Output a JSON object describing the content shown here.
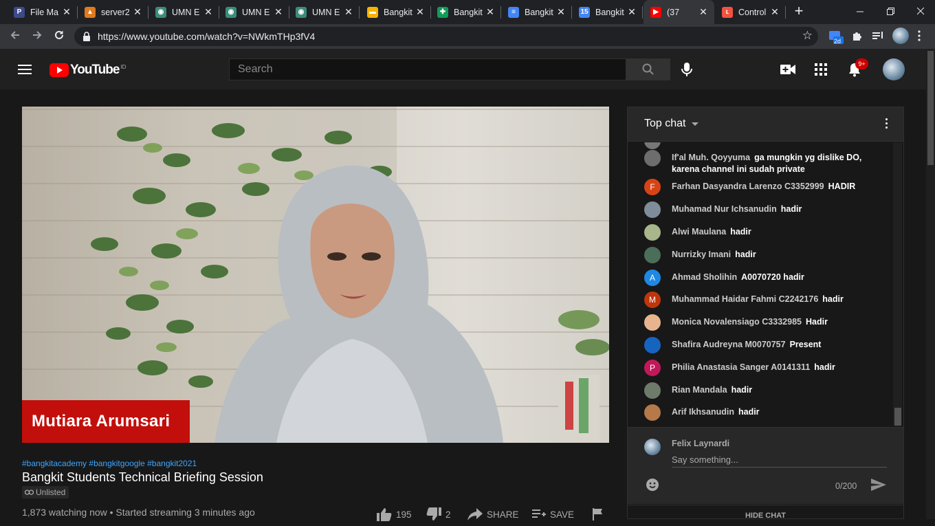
{
  "browser": {
    "tabs": [
      {
        "title": "File Ma",
        "icon": "p-icon",
        "color": "#3c4a8a",
        "glyph": "P"
      },
      {
        "title": "server2",
        "icon": "server-icon",
        "color": "#e07a1f",
        "glyph": "▲"
      },
      {
        "title": "UMN E",
        "icon": "umn-icon",
        "color": "#3a8c7a",
        "glyph": "◉"
      },
      {
        "title": "UMN E",
        "icon": "umn-icon",
        "color": "#3a8c7a",
        "glyph": "◉"
      },
      {
        "title": "UMN E",
        "icon": "umn-icon",
        "color": "#3a8c7a",
        "glyph": "◉"
      },
      {
        "title": "Bangkit",
        "icon": "slides-icon",
        "color": "#f4b400",
        "glyph": "▬"
      },
      {
        "title": "Bangkit",
        "icon": "sheets-icon",
        "color": "#0f9d58",
        "glyph": "✚"
      },
      {
        "title": "Bangkit",
        "icon": "docs-icon",
        "color": "#4285f4",
        "glyph": "≡"
      },
      {
        "title": "Bangkit",
        "icon": "calendar-icon",
        "color": "#4285f4",
        "glyph": "15"
      },
      {
        "title": "(37",
        "icon": "youtube-icon",
        "color": "#ff0000",
        "glyph": "▶"
      },
      {
        "title": "Control",
        "icon": "laravel-icon",
        "color": "#f05340",
        "glyph": "ʟ"
      }
    ],
    "url": "https://www.youtube.com/watch?v=NWkmTHp3fV4",
    "new_tab_label": "+",
    "extension_badge": "2d"
  },
  "youtube": {
    "logo_text": "YouTube",
    "country_code": "ID",
    "search_placeholder": "Search",
    "notification_count": "9+"
  },
  "video": {
    "presenter_name": "Mutiara Arumsari",
    "hashtags": "#bangkitacademy #bangkitgoogle #bangkit2021",
    "title": "Bangkit Students Technical Briefing Session",
    "visibility": "Unlisted",
    "stats": "1,873 watching now • Started streaming 3 minutes ago",
    "likes": "195",
    "dislikes": "2",
    "share_label": "SHARE",
    "save_label": "SAVE"
  },
  "chat": {
    "header": "Top chat",
    "messages": [
      {
        "author": "If'al Muh. Qoyyuma",
        "text": "ga mungkin yg dislike DO, karena channel ini sudah private",
        "avatar_color": "#6d6d6d",
        "avatar_letter": ""
      },
      {
        "author": "Farhan Dasyandra Larenzo C3352999",
        "text": "HADIR",
        "avatar_color": "#d84315",
        "avatar_letter": "F"
      },
      {
        "author": "Muhamad Nur Ichsanudin",
        "text": "hadir",
        "avatar_color": "#7f8c99",
        "avatar_letter": ""
      },
      {
        "author": "Alwi Maulana",
        "text": "hadir",
        "avatar_color": "#a9b58a",
        "avatar_letter": ""
      },
      {
        "author": "Nurrizky Imani",
        "text": "hadir",
        "avatar_color": "#4a6e5a",
        "avatar_letter": ""
      },
      {
        "author": "Ahmad Sholihin",
        "text": "A0070720 hadir",
        "avatar_color": "#1e88e5",
        "avatar_letter": "A"
      },
      {
        "author": "Muhammad Haidar Fahmi C2242176",
        "text": "hadir",
        "avatar_color": "#bf360c",
        "avatar_letter": "M"
      },
      {
        "author": "Monica Novalensiago C3332985",
        "text": "Hadir",
        "avatar_color": "#e8b48e",
        "avatar_letter": ""
      },
      {
        "author": "Shafira Audreyna M0070757",
        "text": "Present",
        "avatar_color": "#1565c0",
        "avatar_letter": ""
      },
      {
        "author": "Philia Anastasia Sanger A0141311",
        "text": "hadir",
        "avatar_color": "#c2185b",
        "avatar_letter": "P"
      },
      {
        "author": "Rian Mandala",
        "text": "hadir",
        "avatar_color": "#6e7a6a",
        "avatar_letter": ""
      },
      {
        "author": "Arif Ikhsanudin",
        "text": "hadir",
        "avatar_color": "#b5794a",
        "avatar_letter": ""
      }
    ],
    "my_name": "Felix Laynardi",
    "input_placeholder": "Say something...",
    "char_count": "0/200",
    "hide_chat_label": "HIDE CHAT"
  }
}
